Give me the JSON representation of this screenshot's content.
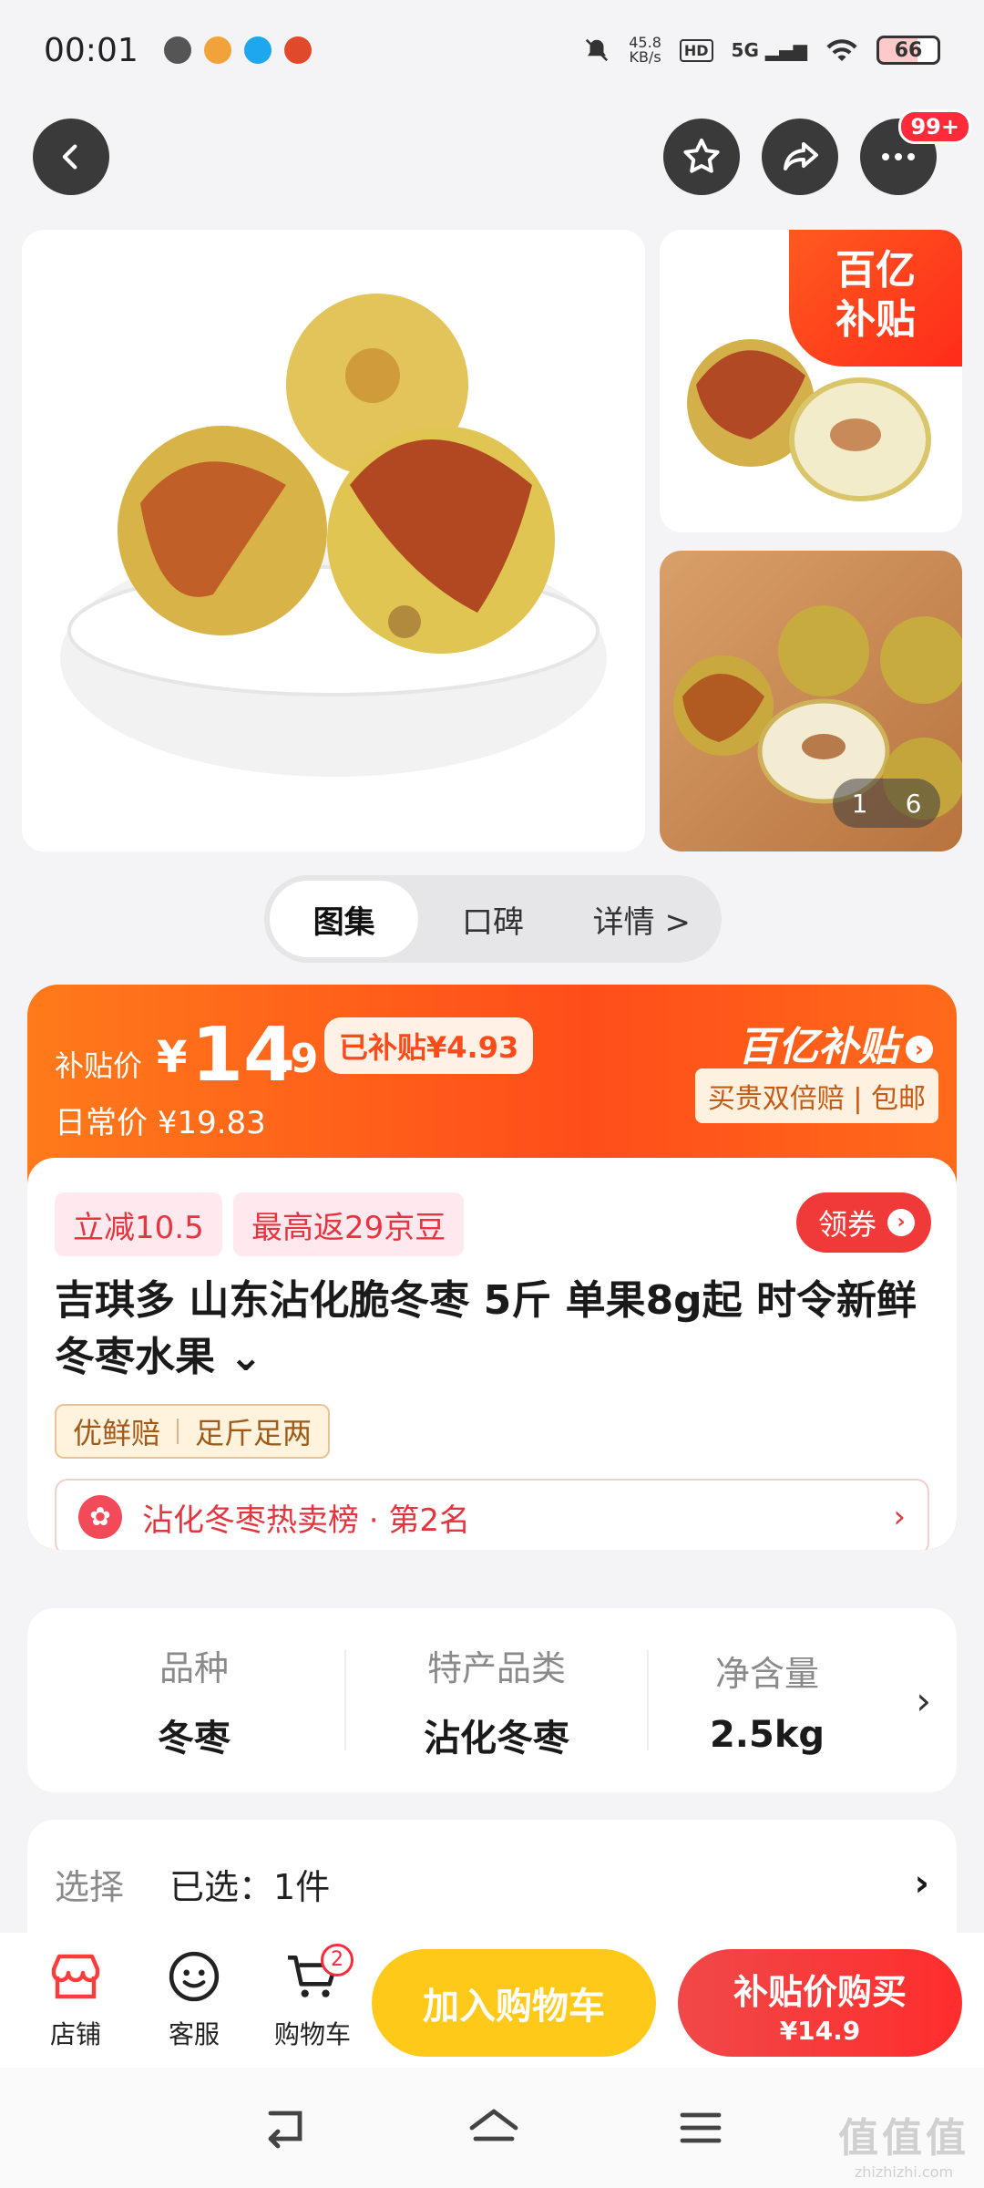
{
  "status_bar": {
    "time": "00:01",
    "net_speed_value": "45.8",
    "net_speed_unit": "KB/s",
    "hd": "HD",
    "signal": "5G",
    "battery": "66"
  },
  "nav": {
    "badge": "99+"
  },
  "gallery": {
    "corner_badge_line1": "百亿",
    "corner_badge_line2": "补贴",
    "pager_current": "1",
    "pager_total": "6"
  },
  "tabs": [
    {
      "label": "图集"
    },
    {
      "label": "口碑"
    },
    {
      "label": "详情 >"
    }
  ],
  "price": {
    "label": "补贴价",
    "yen": "¥",
    "integer": "14",
    "decimal": ".9",
    "subsidy_tag": "已补贴¥4.93",
    "daily_label": "日常价 ¥19.83",
    "brand": "百亿补贴",
    "guarantee": "买贵双倍赔 | 包邮"
  },
  "promo": {
    "tag1": "立减10.5",
    "tag2": "最高返29京豆",
    "coupon": "领券"
  },
  "product": {
    "title": "吉琪多 山东沾化脆冬枣 5斤 单果8g起 时令新鲜冬枣水果 ⌄",
    "chip1": "优鲜赔",
    "chip2": "足斤足两",
    "rank": "沾化冬枣热卖榜 · 第2名"
  },
  "attributes": [
    {
      "key": "品种",
      "value": "冬枣"
    },
    {
      "key": "特产品类",
      "value": "沾化冬枣"
    },
    {
      "key": "净含量",
      "value": "2.5kg"
    }
  ],
  "select": {
    "key": "选择",
    "value": "已选：1件"
  },
  "bottom": {
    "shop": "店铺",
    "service": "客服",
    "cart": "购物车",
    "cart_count": "2",
    "add_to_cart": "加入购物车",
    "buy_line1": "补贴价购买",
    "buy_line2": "¥14.9"
  },
  "watermark": {
    "big": "值值值",
    "small": "zhizhizhi.com"
  },
  "colors": {
    "accent_orange": "#ff5a1a",
    "accent_red": "#f03a3a",
    "cart_yellow": "#ffc919"
  }
}
